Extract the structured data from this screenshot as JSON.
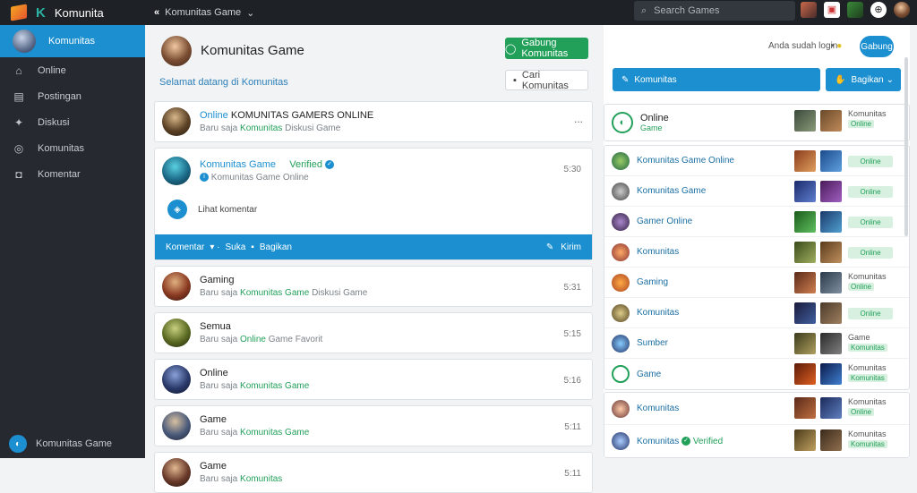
{
  "topbar": {
    "brand": "Komunita",
    "crumb": "Komunitas Game",
    "search_placeholder": "Search Games",
    "icons": [
      "avatar-icon",
      "gift-icon",
      "game-icon",
      "settings-icon",
      "profile-icon"
    ]
  },
  "sidebar": {
    "items": [
      {
        "label": "Komunitas",
        "icon": "avatar-icon",
        "active": true
      },
      {
        "label": "Online",
        "icon": "home-icon"
      },
      {
        "label": "Postingan",
        "icon": "chart-icon"
      },
      {
        "label": "Diskusi",
        "icon": "chat-icon"
      },
      {
        "label": "Komunitas",
        "icon": "globe-icon"
      },
      {
        "label": "Komentar",
        "icon": "comment-icon"
      }
    ],
    "footer": "Komunitas Game"
  },
  "feed": {
    "title": "Komunitas Game",
    "subtitle": "Selamat datang di Komunitas",
    "primary_button": "Gabung Komunitas",
    "secondary_button": "Cari Komunitas",
    "posts": [
      {
        "name": "Online",
        "title": "KOMUNITAS GAMERS ONLINE",
        "meta_pre": "Baru saja",
        "meta_green": "Komunitas",
        "meta_post": "Diskusi Game",
        "time": "",
        "more": "..."
      },
      {
        "expanded": true,
        "name": "Komunitas Game",
        "verified": "Verified",
        "meta": "Komunitas Game Online",
        "time": "5:30",
        "mid": "Lihat komentar",
        "bar_left": "Komentar",
        "bar_mid": "Suka",
        "bar_mid2": "Bagikan",
        "bar_right": "Kirim"
      },
      {
        "name": "Gaming",
        "meta_pre": "Baru saja",
        "meta_green": "Komunitas Game",
        "meta_post": "Diskusi Game",
        "time": "5:31"
      },
      {
        "name": "Semua",
        "meta_pre": "Baru saja",
        "meta_green": "Online",
        "meta_post": "Game Favorit",
        "time": "5:15"
      },
      {
        "name": "Online",
        "meta_pre": "Baru saja",
        "meta_green": "Komunitas Game",
        "meta_post": "",
        "time": "5:16"
      },
      {
        "name": "Game",
        "meta_pre": "Baru saja",
        "meta_green": "Komunitas Game",
        "meta_post": "",
        "time": "5:11"
      },
      {
        "name": "Game",
        "meta_pre": "Baru saja",
        "meta_green": "Komunitas",
        "meta_post": "",
        "time": "5:11"
      }
    ]
  },
  "right": {
    "label": "Anda sudah login",
    "mini": "•",
    "round_button": "Gabung",
    "action1": "Komunitas",
    "action2": "Bagikan",
    "online": {
      "title": "Online",
      "sub": "Game",
      "tag_title": "Komunitas",
      "tag": "Online"
    },
    "rows": [
      {
        "name": "Komunitas Game Online",
        "tag": "Online"
      },
      {
        "name": "Komunitas Game",
        "tag": "Online"
      },
      {
        "name": "Gamer Online",
        "tag": "Online"
      },
      {
        "name": "Komunitas",
        "tag": "Online"
      },
      {
        "name": "Gaming",
        "tag_title": "Komunitas",
        "tag": "Online"
      },
      {
        "name": "Komunitas",
        "tag": "Online"
      },
      {
        "name": "Sumber",
        "tag_title": "Game",
        "tag": "Komunitas"
      },
      {
        "name": "Game",
        "tag_title": "Komunitas",
        "tag": "Komunitas"
      }
    ],
    "rows2": [
      {
        "name": "Komunitas",
        "tag_title": "Komunitas",
        "tag": "Online"
      },
      {
        "name": "Komunitas",
        "verified_label": "Verified",
        "tag_title": "Komunitas",
        "tag": "Komunitas"
      }
    ]
  },
  "colors": {
    "accent": "#1b8fcf",
    "green": "#22a05a",
    "sidebar": "#262a30",
    "topbar": "#1e2227"
  }
}
